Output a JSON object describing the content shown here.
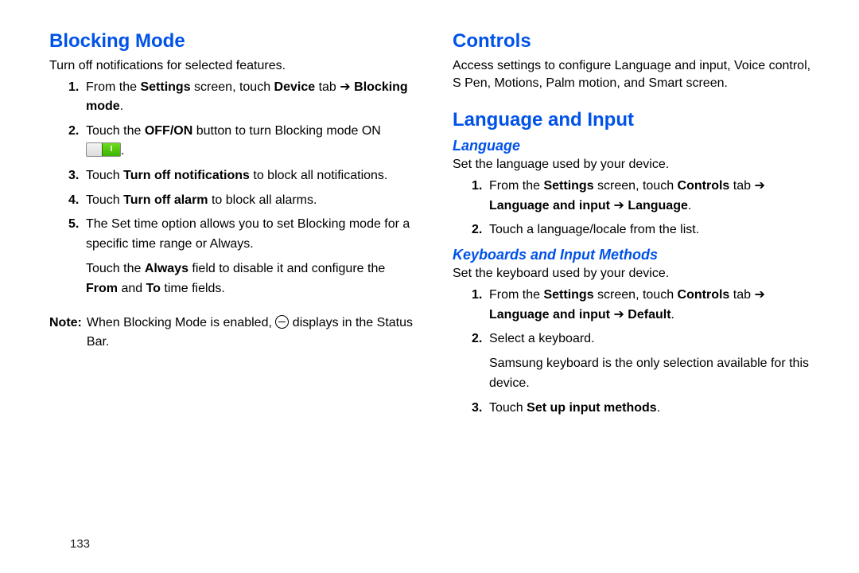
{
  "page_number": "133",
  "left": {
    "heading": "Blocking Mode",
    "intro": "Turn off notifications for selected features.",
    "step1_a": "From the ",
    "step1_b": "Settings",
    "step1_c": " screen, touch ",
    "step1_d": "Device",
    "step1_e": " tab ",
    "arrow": "➔",
    "step1_f": "Blocking mode",
    "step1_g": ".",
    "step2_a": "Touch the ",
    "step2_b": "OFF/ON",
    "step2_c": " button to turn Blocking mode ON ",
    "step2_d": ".",
    "step3_a": "Touch ",
    "step3_b": "Turn off notifications",
    "step3_c": " to block all notifications.",
    "step4_a": "Touch ",
    "step4_b": "Turn off alarm",
    "step4_c": " to block all alarms.",
    "step5": "The Set time option allows you to set Blocking mode for a specific time range or Always.",
    "cont_a": "Touch the ",
    "cont_b": "Always",
    "cont_c": " field to disable it and configure the ",
    "cont_d": "From",
    "cont_e": " and ",
    "cont_f": "To",
    "cont_g": " time fields.",
    "note_label": "Note:",
    "note_a": " When Blocking Mode is enabled, ",
    "note_b": " displays in the Status Bar."
  },
  "right": {
    "heading1": "Controls",
    "intro1": "Access settings to configure Language and input, Voice control, S Pen, Motions, Palm motion, and Smart screen.",
    "heading2": "Language and Input",
    "sub1": "Language",
    "sub1_intro": "Set the language used by your device.",
    "s1_a": "From the ",
    "s1_b": "Settings",
    "s1_c": " screen, touch ",
    "s1_d": "Controls",
    "s1_e": " tab ",
    "arrow": "➔",
    "s1_f": "Language and input",
    "s1_g": "Language",
    "s1_h": ".",
    "s2": "Touch a language/locale from the list.",
    "sub2": "Keyboards and Input Methods",
    "sub2_intro": "Set the keyboard used by your device.",
    "k1_a": "From the ",
    "k1_b": "Settings",
    "k1_c": " screen, touch ",
    "k1_d": "Controls",
    "k1_e": " tab ",
    "k1_f": "Language and input",
    "k1_g": " Default",
    "k1_h": ".",
    "k2": "Select a keyboard.",
    "k2_cont": "Samsung keyboard is the only selection available for this device.",
    "k3_a": "Touch ",
    "k3_b": "Set up input methods",
    "k3_c": "."
  }
}
